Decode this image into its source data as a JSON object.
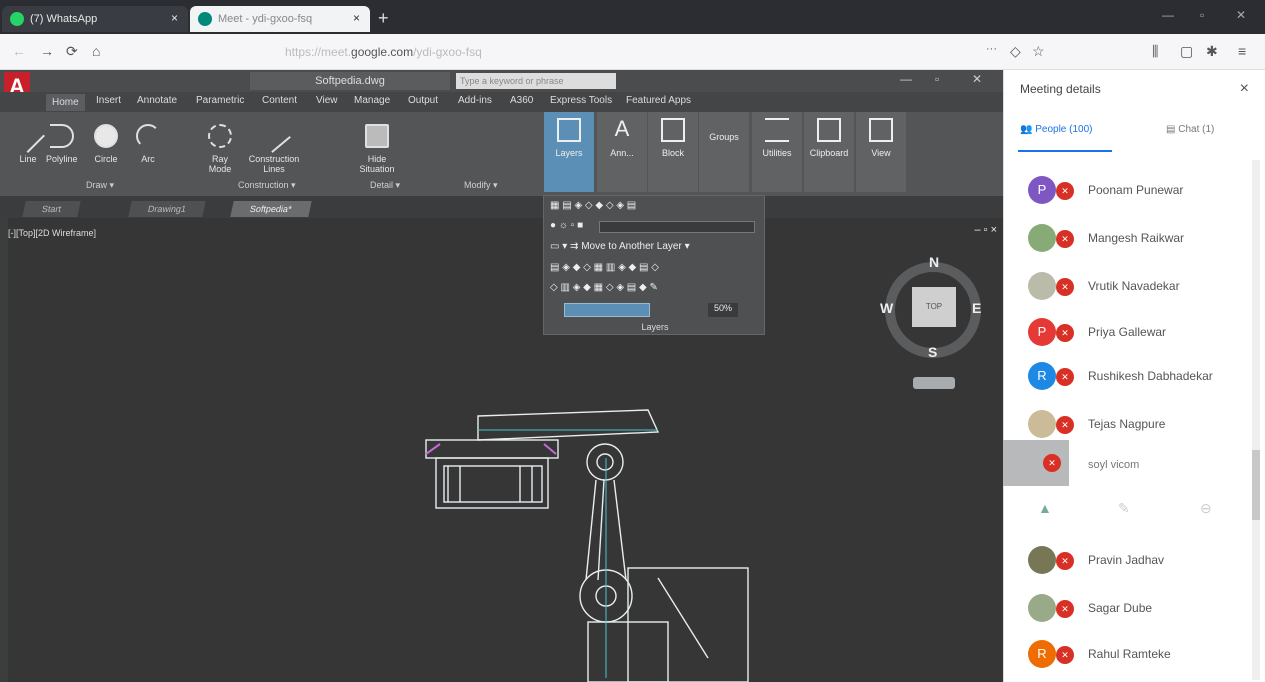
{
  "browser": {
    "tabs": [
      {
        "title": "(7) WhatsApp",
        "close": "×"
      },
      {
        "title": "Meet - ydi-gxoo-fsq",
        "close": "×"
      }
    ],
    "new_tab": "+",
    "url_prefix": "https://meet.",
    "url_host": "google.com",
    "url_path": "/ydi-gxoo-fsq",
    "nav": {
      "back": "←",
      "forward": "→",
      "reload": "⟳",
      "home": "⌂",
      "menu": "···"
    }
  },
  "autocad": {
    "doc_title": "Softpedia.dwg",
    "search_placeholder": "Type a keyword or phrase",
    "menus": [
      "Home",
      "Insert",
      "Annotate",
      "Parametric",
      "Content",
      "View",
      "Manage",
      "Output",
      "Add-ins",
      "A360",
      "Express Tools",
      "Featured Apps"
    ],
    "draw_tools": [
      "Line",
      "Polyline",
      "Circle",
      "Arc"
    ],
    "ray_mode": "Ray Mode",
    "construction_lines": "Construction Lines",
    "hide_situation": "Hide Situation",
    "panels": {
      "draw": "Draw ▾",
      "construction": "Construction ▾",
      "detail": "Detail ▾",
      "modify": "Modify ▾"
    },
    "big_buttons": [
      "Layers",
      "Ann...",
      "Block",
      "Groups",
      "Utilities",
      "Clipboard",
      "View"
    ],
    "file_tabs": [
      "Start",
      "Drawing1",
      "Softpedia*"
    ],
    "viewport_label": "[-][Top][2D Wireframe]",
    "viewport_controls": "– ▫ ×",
    "layers_popup": {
      "move_layer": "Move to Another Layer",
      "percent": "50%",
      "footer": "Layers"
    },
    "viewcube": {
      "n": "N",
      "s": "S",
      "e": "E",
      "w": "W",
      "face": "TOP"
    }
  },
  "meet": {
    "title": "Meeting details",
    "close": "×",
    "people_tab": "People (100)",
    "chat_tab": "Chat (1)",
    "participants_top": [
      {
        "initial": "P",
        "name": "Poonam Punewar",
        "color": "#7e57c2"
      },
      {
        "initial": "",
        "name": "Mangesh Raikwar",
        "color": "#8a7"
      },
      {
        "initial": "",
        "name": "Vrutik Navadekar",
        "color": "#bba"
      },
      {
        "initial": "P",
        "name": "Priya Gallewar",
        "color": "#e53935"
      },
      {
        "initial": "R",
        "name": "Rushikesh Dabhadekar",
        "color": "#1e88e5"
      },
      {
        "initial": "",
        "name": "Tejas Nagpure",
        "color": "#cb9"
      }
    ],
    "presenting_label": "soyl vicom",
    "participants_bottom": [
      {
        "initial": "",
        "name": "Pravin Jadhav",
        "color": "#775"
      },
      {
        "initial": "",
        "name": "Sagar Dube",
        "color": "#9a8"
      },
      {
        "initial": "R",
        "name": "Rahul Ramteke",
        "color": "#ef6c00"
      }
    ],
    "mic_icon": "mic-off-icon"
  }
}
